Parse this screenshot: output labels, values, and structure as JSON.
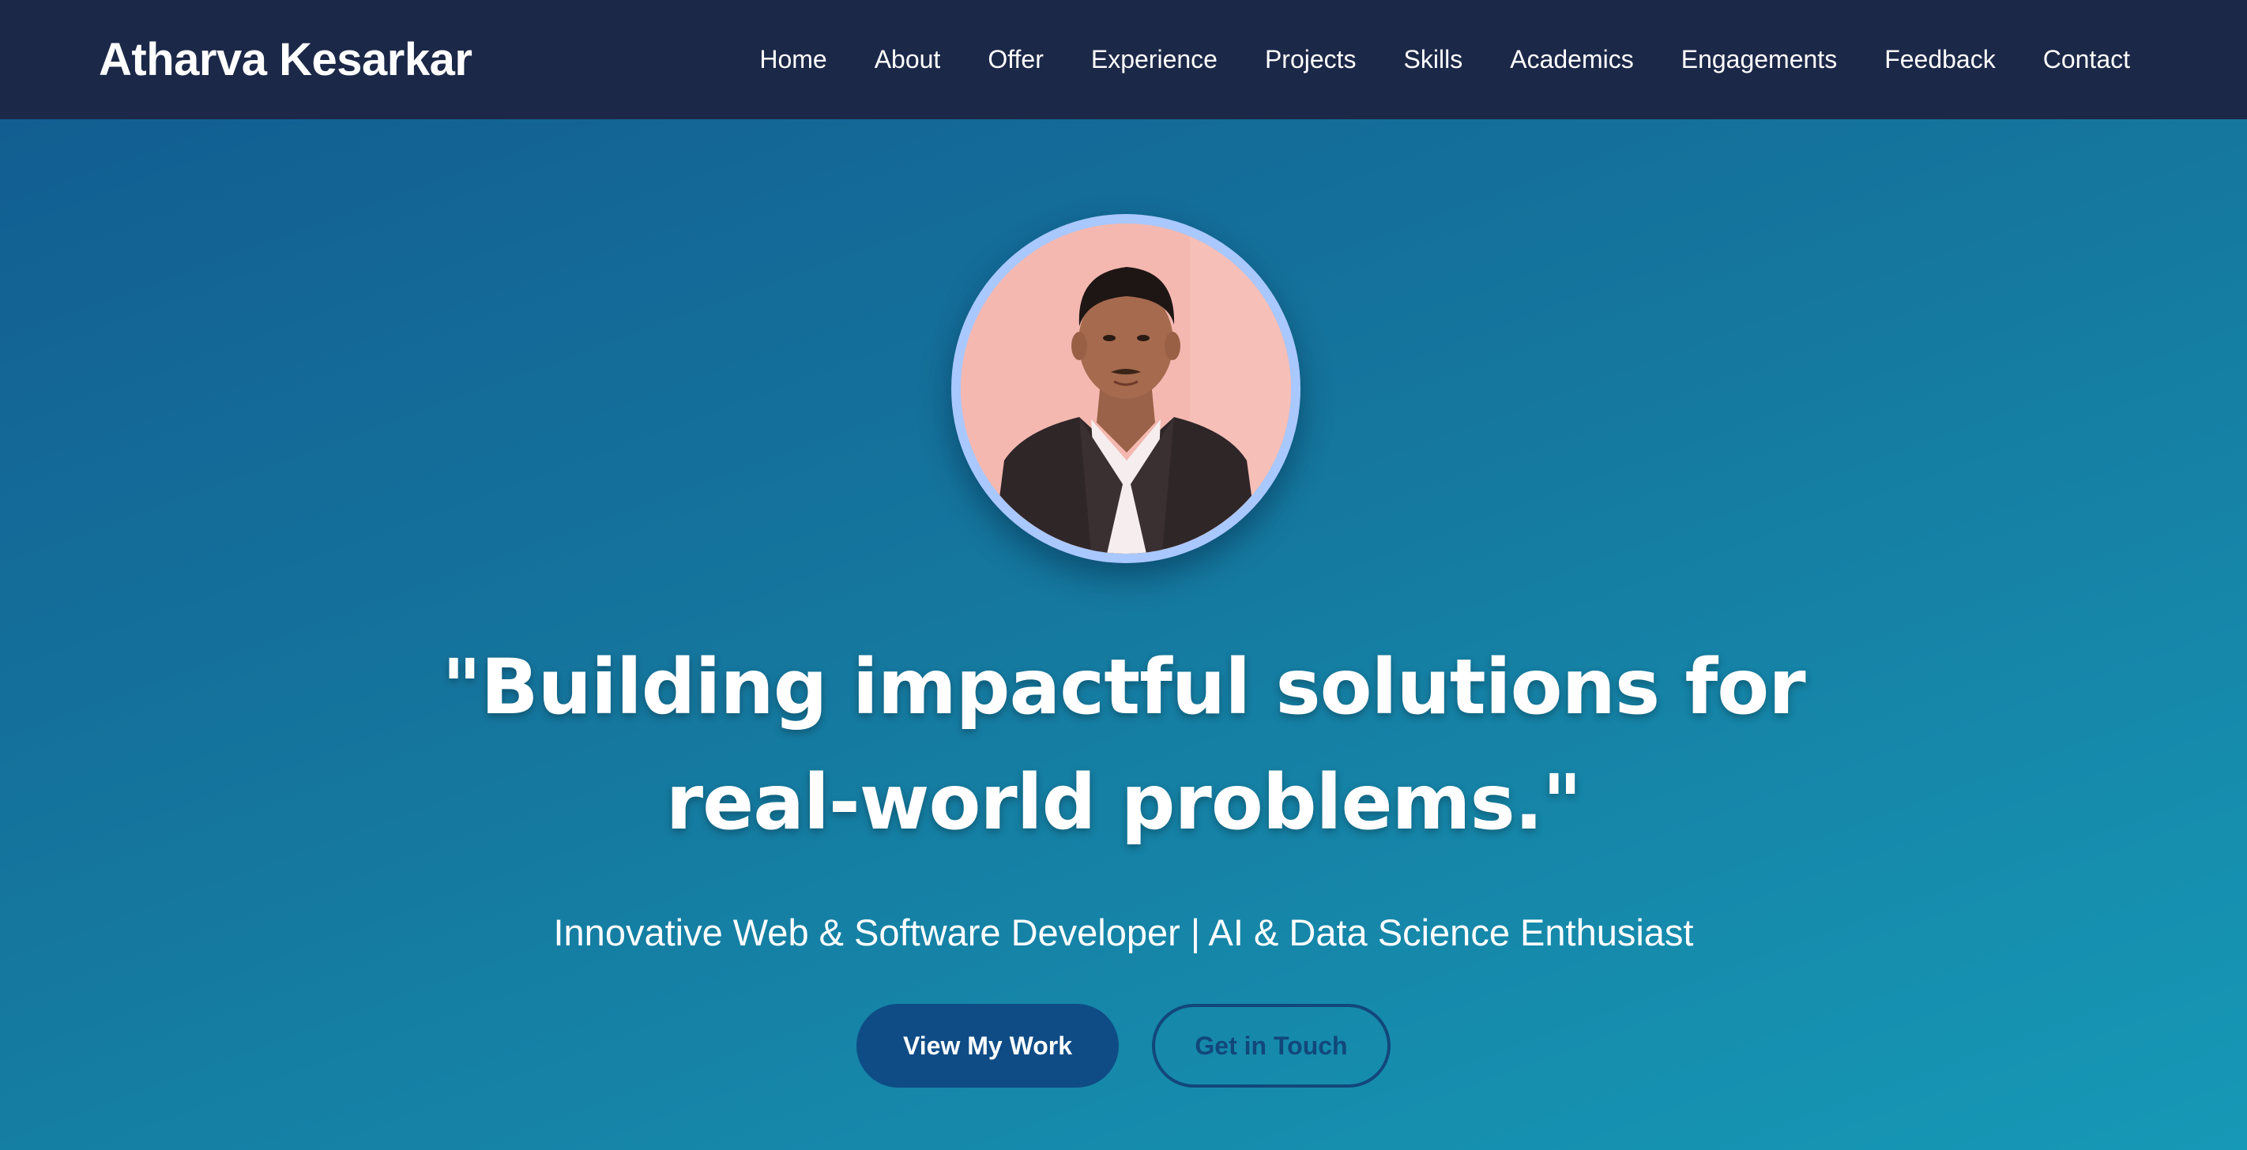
{
  "navbar": {
    "brand": "Atharva Kesarkar",
    "links": [
      {
        "label": "Home"
      },
      {
        "label": "About"
      },
      {
        "label": "Offer"
      },
      {
        "label": "Experience"
      },
      {
        "label": "Projects"
      },
      {
        "label": "Skills"
      },
      {
        "label": "Academics"
      },
      {
        "label": "Engagements"
      },
      {
        "label": "Feedback"
      },
      {
        "label": "Contact"
      }
    ]
  },
  "hero": {
    "headline": "\"Building impactful solutions for real-world problems.\"",
    "tagline": "Innovative Web & Software Developer | AI & Data Science Enthusiast",
    "buttons": {
      "primary": "View My Work",
      "secondary": "Get in Touch"
    }
  },
  "colors": {
    "navbar_bg": "#1c2848",
    "hero_gradient_start": "#125e92",
    "hero_gradient_end": "#1699b6",
    "primary_button": "#0f4c85",
    "avatar_ring": "#a9c8ff"
  }
}
